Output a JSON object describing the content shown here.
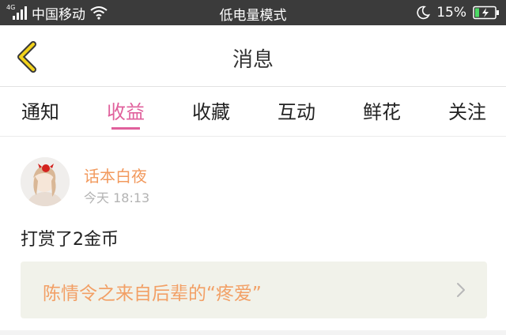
{
  "status_bar": {
    "network_type": "4G",
    "carrier": "中国移动",
    "mode": "低电量模式",
    "battery_percent": "15%",
    "icons": [
      "signal-icon",
      "wifi-icon",
      "moon-icon",
      "battery-charging-icon"
    ]
  },
  "header": {
    "title": "消息",
    "back_icon": "chevron-left-icon",
    "accent_color": "#f2d21b"
  },
  "tabs": [
    {
      "label": "通知",
      "active": false
    },
    {
      "label": "收益",
      "active": true
    },
    {
      "label": "收藏",
      "active": false
    },
    {
      "label": "互动",
      "active": false
    },
    {
      "label": "鲜花",
      "active": false
    },
    {
      "label": "关注",
      "active": false
    }
  ],
  "active_tab_color": "#e0609c",
  "message": {
    "username": "话本白夜",
    "timestamp": "今天 18:13",
    "content": "打赏了2金币",
    "book_title": "陈情令之来自后辈的“疼爱”",
    "link_icon": "chevron-right-icon"
  }
}
